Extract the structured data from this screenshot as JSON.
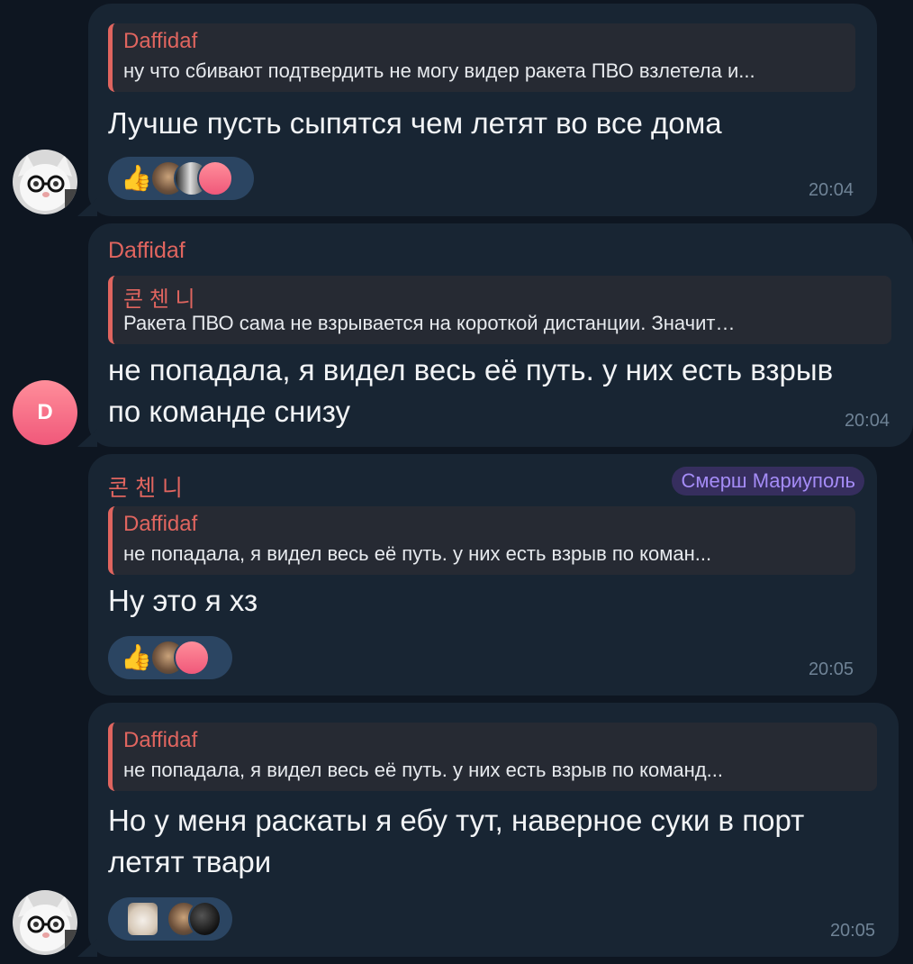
{
  "messages": [
    {
      "reply": {
        "name": "Daffidaf",
        "text": "ну что сбивают подтвердить не могу видер ракета ПВО взлетела и..."
      },
      "text": "Лучше пусть сыпятся чем летят во все дома",
      "reactions": {
        "emoji": "👍"
      },
      "time": "20:04"
    },
    {
      "sender": "Daffidaf",
      "avatar_letter": "D",
      "reply": {
        "name": "콘 첸 니",
        "text": "Ракета ПВО сама не взрывается на короткой дистанции. Значит…"
      },
      "text_lines": [
        "не попадала, я видел весь её путь. у них есть взрыв",
        "по команде снизу"
      ],
      "time": "20:04"
    },
    {
      "sender": "콘 첸 니",
      "badge": "Смерш Мариуполь",
      "reply": {
        "name": "Daffidaf",
        "text": "не попадала, я видел весь её путь. у них есть взрыв по коман..."
      },
      "text": "Ну это я хз",
      "reactions": {
        "emoji": "👍"
      },
      "time": "20:05"
    },
    {
      "reply": {
        "name": "Daffidaf",
        "text": "не попадала, я видел весь её путь. у них есть взрыв по команд..."
      },
      "text_lines": [
        "Но у меня раскаты я ебу тут, наверное суки в порт",
        "летят твари"
      ],
      "time": "20:05"
    }
  ],
  "colors": {
    "background": "#0e1621",
    "bubble": "#182533",
    "sender_name": "#e0655f",
    "badge_text": "#a58cf7",
    "reaction_pill": "#2b4562"
  }
}
